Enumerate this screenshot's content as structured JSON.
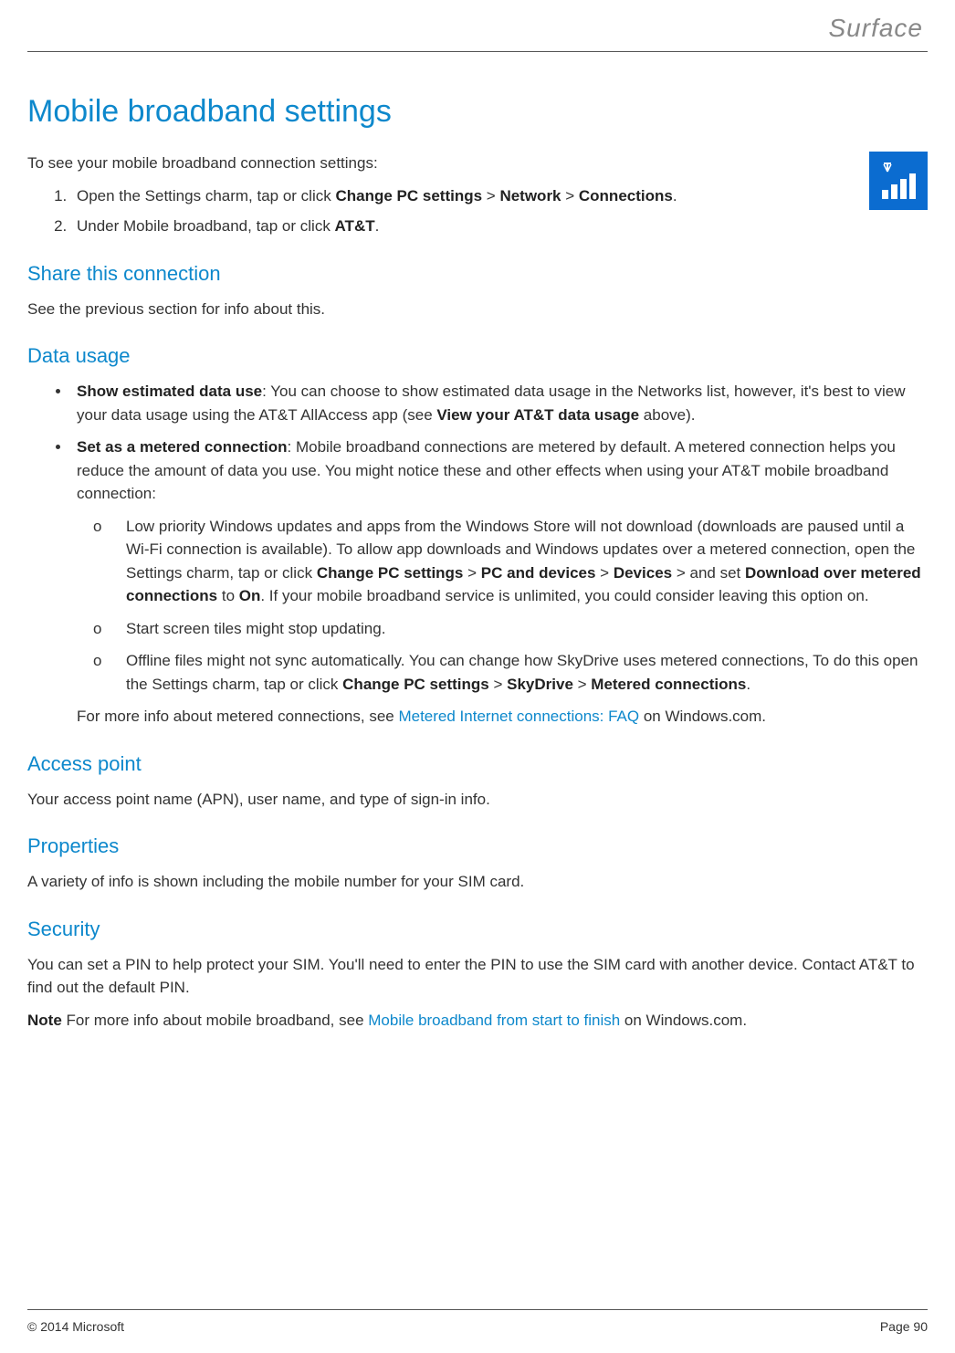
{
  "brand": "Surface",
  "title": "Mobile broadband settings",
  "intro": "To see your mobile broadband connection settings:",
  "steps": {
    "s1_a": "Open the Settings charm, tap or click ",
    "s1_b1": "Change PC settings",
    "s1_gt1": " > ",
    "s1_b2": "Network",
    "s1_gt2": " > ",
    "s1_b3": "Connections",
    "s1_end": ".",
    "s2_a": "Under Mobile broadband, tap or click ",
    "s2_b": "AT&T",
    "s2_end": "."
  },
  "share": {
    "heading": "Share this connection",
    "text": "See the previous section for info about this."
  },
  "datausage": {
    "heading": "Data usage",
    "b1_lead": "Show estimated data use",
    "b1_colon": ":  ",
    "b1_text_a": "You can choose to show estimated data usage in the Networks list, however, it's best to view your data usage using the AT&T AllAccess app (see ",
    "b1_bold": "View your AT&T data usage",
    "b1_text_b": " above).",
    "b2_lead": "Set as a metered connection",
    "b2_colon": ":  ",
    "b2_text": "Mobile broadband connections are metered by default. A metered connection helps you reduce the amount of data you use. You might notice these and other effects when using your AT&T mobile broadband connection:",
    "o1_a": "Low priority Windows updates and apps from the Windows Store will not download (downloads are paused until a Wi-Fi connection is available). To allow app downloads and Windows updates over a metered connection, open the Settings charm, tap or click ",
    "o1_b1": "Change PC settings",
    "o1_gt1": " > ",
    "o1_b2": "PC and devices",
    "o1_gt2": " > ",
    "o1_b3": "Devices",
    "o1_gt3": " > ",
    "o1_mid": "and set ",
    "o1_b4": "Download over metered connections",
    "o1_to": " to ",
    "o1_b5": "On",
    "o1_end": ". If your mobile broadband service is unlimited, you could consider leaving this option on.",
    "o2": "Start screen tiles might stop updating.",
    "o3_a": "Offline files might not sync automatically. You can change how SkyDrive uses metered connections, To do this open the Settings charm, tap or click ",
    "o3_b1": "Change PC settings",
    "o3_gt1": " > ",
    "o3_b2": "SkyDrive",
    "o3_gt2": " > ",
    "o3_b3": "Metered connections",
    "o3_end": ".",
    "more_a": "For more info about metered connections, see ",
    "more_link": "Metered Internet connections: FAQ",
    "more_b": " on Windows.com."
  },
  "access": {
    "heading": "Access point",
    "text": "Your access point name (APN), user name, and type of sign-in info."
  },
  "props": {
    "heading": "Properties",
    "text": "A variety of info is shown including the mobile number for your SIM card."
  },
  "security": {
    "heading": "Security",
    "text": "You can set a PIN to help protect your SIM. You'll need to enter the PIN to use the SIM card with another device. Contact AT&T to find out the default PIN.",
    "note_lead": "Note",
    "note_a": "  For more info about mobile broadband, see ",
    "note_link": "Mobile broadband from start to finish",
    "note_b": " on Windows.com."
  },
  "footer": {
    "copyright": "© 2014 Microsoft",
    "page": "Page 90"
  }
}
